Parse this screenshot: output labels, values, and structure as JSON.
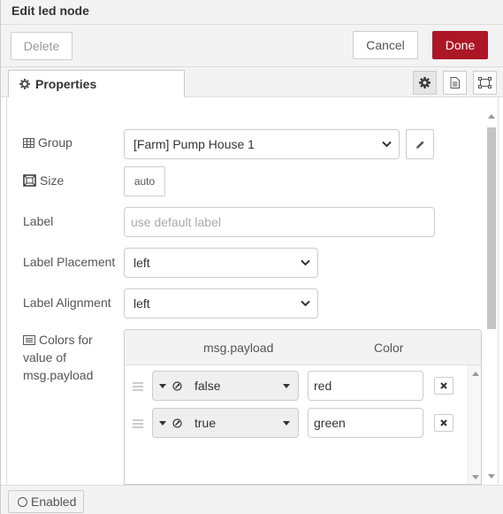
{
  "header": {
    "title": "Edit led node"
  },
  "toolbar": {
    "delete_label": "Delete",
    "cancel_label": "Cancel",
    "done_label": "Done"
  },
  "tabs": {
    "properties_label": "Properties",
    "icons": [
      "gear-icon",
      "description-icon",
      "appearance-icon"
    ]
  },
  "form": {
    "group": {
      "label": "Group",
      "value": "[Farm] Pump House 1"
    },
    "size": {
      "label": "Size",
      "value": "auto"
    },
    "label": {
      "label": "Label",
      "placeholder": "use default label"
    },
    "placement": {
      "label": "Label Placement",
      "value": "left"
    },
    "alignment": {
      "label": "Label Alignment",
      "value": "left"
    },
    "colors": {
      "label_lines": [
        "Colors for",
        "value of",
        "msg.payload"
      ],
      "col_payload": "msg.payload",
      "col_color": "Color",
      "rows": [
        {
          "value": "false",
          "color": "red"
        },
        {
          "value": "true",
          "color": "green"
        }
      ]
    }
  },
  "footer": {
    "enabled_label": "Enabled"
  },
  "colors": {
    "done_bg": "#ad1625",
    "accent_text": "#333333"
  }
}
